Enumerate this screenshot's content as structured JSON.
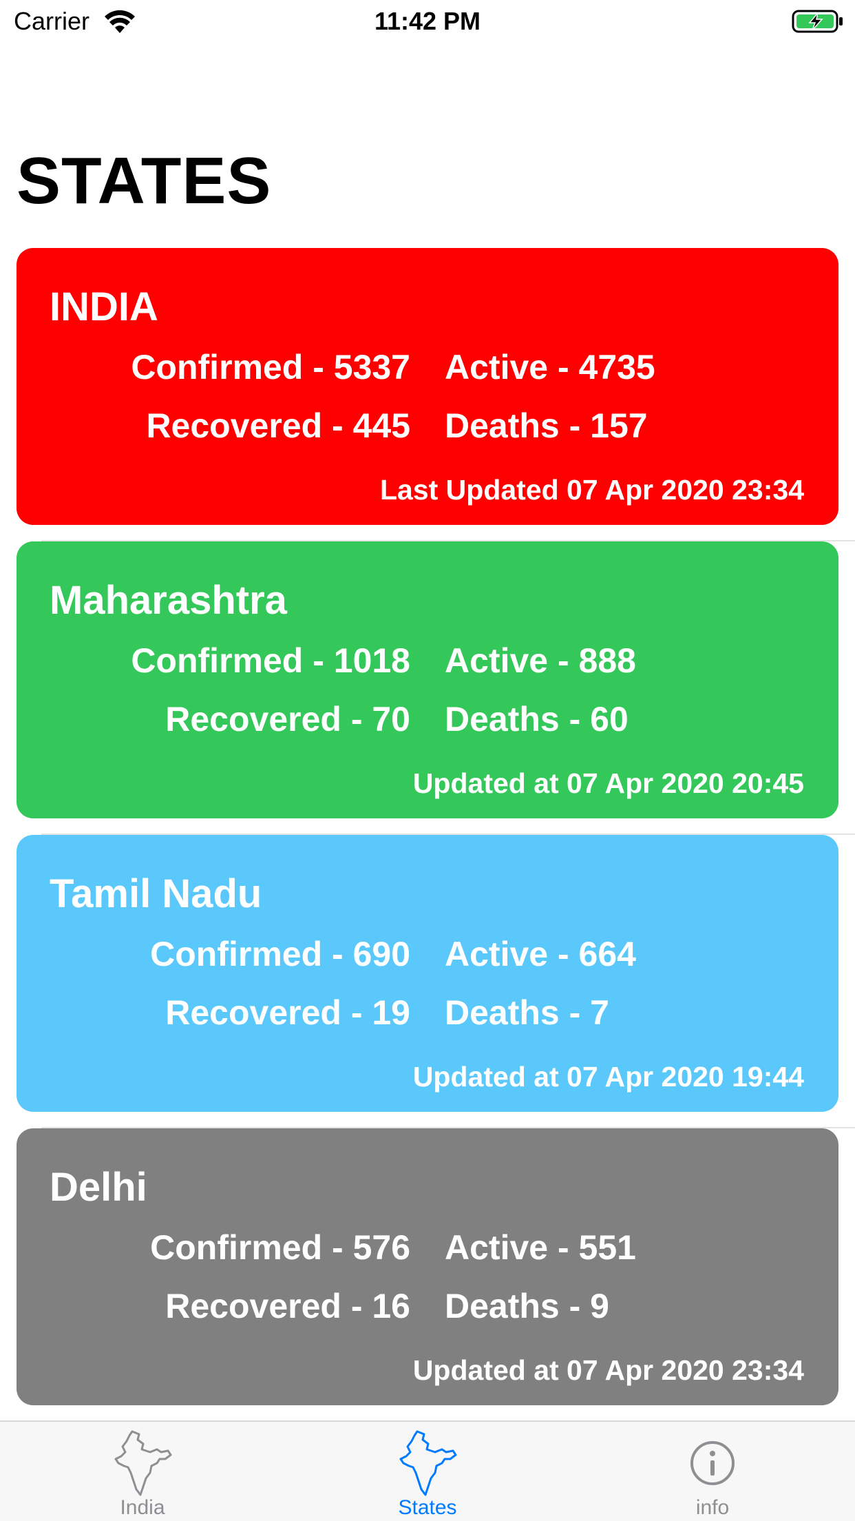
{
  "status_bar": {
    "carrier": "Carrier",
    "time": "11:42 PM",
    "battery_icon": "battery-charging-icon",
    "wifi_icon": "wifi-icon"
  },
  "page": {
    "title": "STATES"
  },
  "cards": [
    {
      "title": "INDIA",
      "confirmed": "Confirmed - 5337",
      "active": "Active - 4735",
      "recovered": "Recovered - 445",
      "deaths": "Deaths - 157",
      "updated": "Last Updated 07 Apr 2020 23:34",
      "color": "#ff0000"
    },
    {
      "title": "Maharashtra",
      "confirmed": "Confirmed - 1018",
      "active": "Active - 888",
      "recovered": "Recovered - 70",
      "deaths": "Deaths - 60",
      "updated": "Updated at 07 Apr 2020 20:45",
      "color": "#34c759"
    },
    {
      "title": "Tamil Nadu",
      "confirmed": "Confirmed - 690",
      "active": "Active - 664",
      "recovered": "Recovered - 19",
      "deaths": "Deaths - 7",
      "updated": "Updated at 07 Apr 2020 19:44",
      "color": "#5ac8fa"
    },
    {
      "title": "Delhi",
      "confirmed": "Confirmed - 576",
      "active": "Active - 551",
      "recovered": "Recovered - 16",
      "deaths": "Deaths - 9",
      "updated": "Updated at 07 Apr 2020 23:34",
      "color": "#808080"
    }
  ],
  "tab_bar": {
    "tabs": [
      {
        "label": "India",
        "icon": "india-map-icon",
        "selected": false
      },
      {
        "label": "States",
        "icon": "india-map-icon",
        "selected": true
      },
      {
        "label": "info",
        "icon": "info-icon",
        "selected": false
      }
    ],
    "active_color": "#007aff",
    "inactive_color": "#8e8e93"
  }
}
